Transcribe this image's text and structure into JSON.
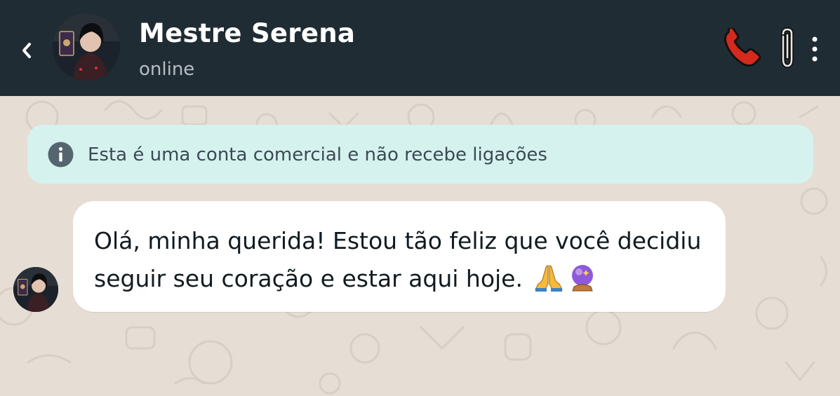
{
  "header": {
    "name": "Mestre Serena",
    "status": "online",
    "back_icon": "chevron-left-icon",
    "call_icon": "phone-icon",
    "attach_icon": "paperclip-icon",
    "menu_icon": "more-vertical-icon",
    "background_color": "#202c33"
  },
  "banner": {
    "icon": "info-icon",
    "text": "Esta é uma conta comercial e não recebe ligações",
    "background_color": "#d5f2ee"
  },
  "messages": [
    {
      "sender": "Mestre Serena",
      "line1": "Olá, minha querida! Estou tão feliz que você decidiu",
      "line2": "seguir seu coração e estar aqui hoje.",
      "emojis": [
        "folded-hands-emoji",
        "crystal-ball-emoji"
      ]
    }
  ],
  "colors": {
    "chat_background": "#e6ddd4",
    "bubble": "#ffffff",
    "call_icon": "#d42a1e"
  }
}
